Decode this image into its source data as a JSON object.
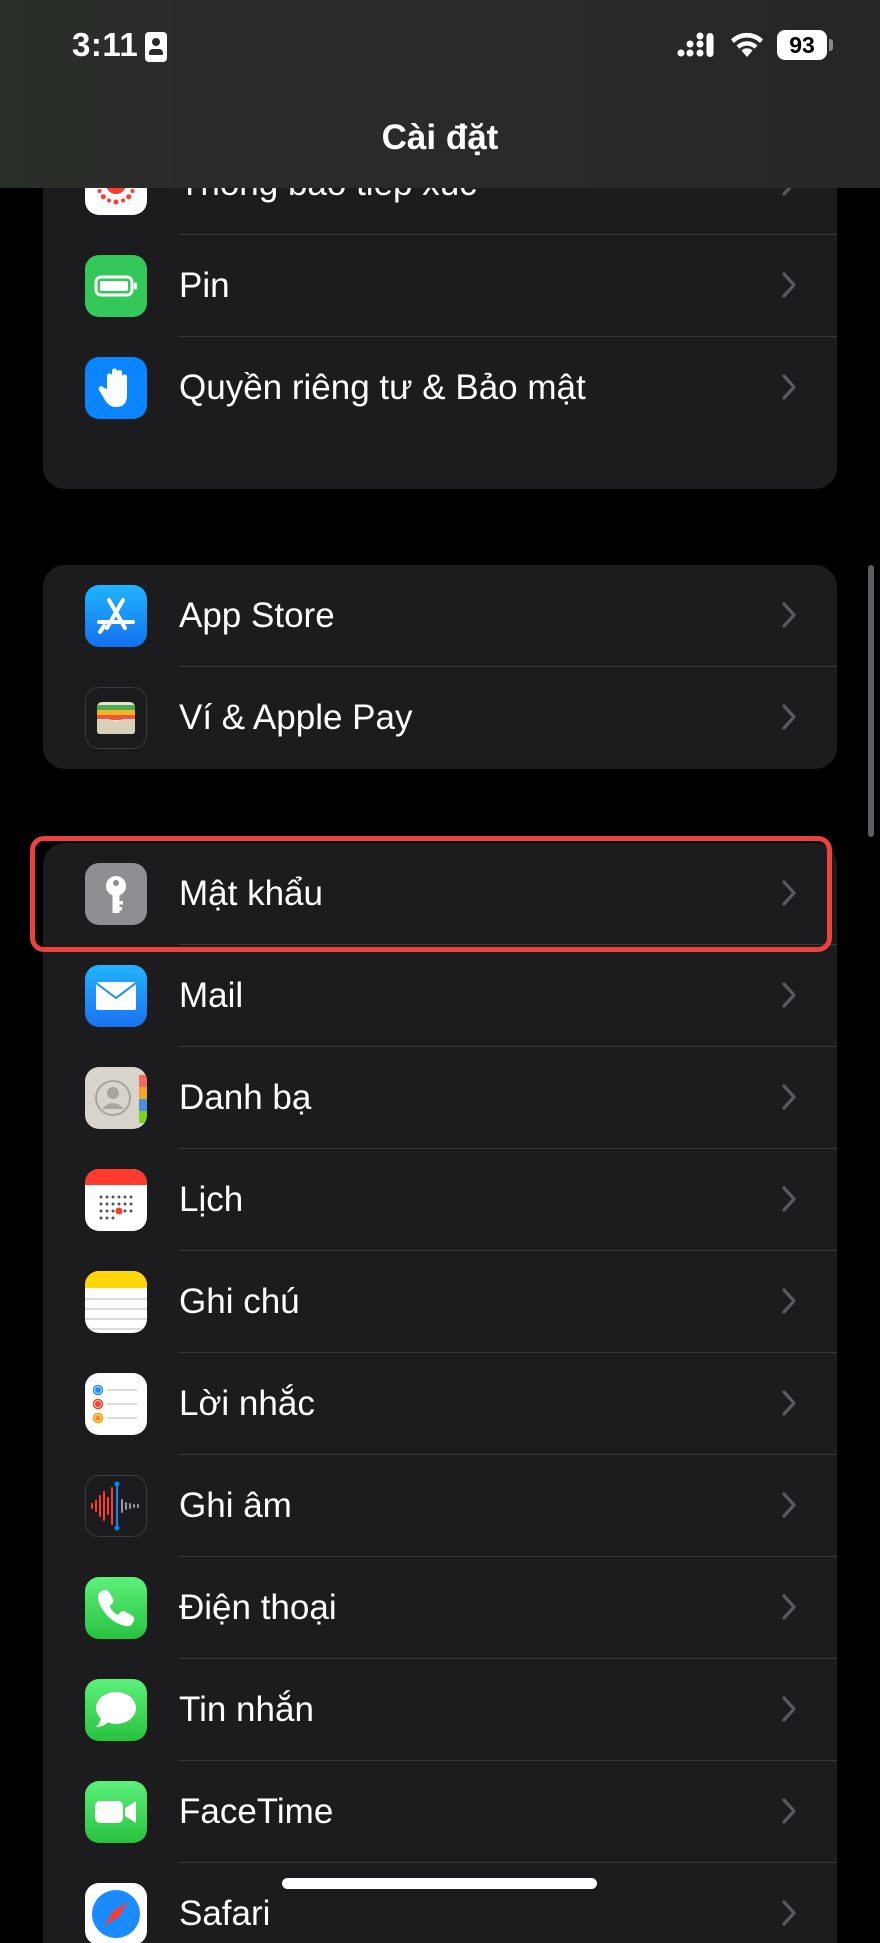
{
  "status_bar": {
    "time": "3:11",
    "battery": "93"
  },
  "nav": {
    "title": "Cài đặt"
  },
  "group1": [
    {
      "label": "Thông báo tiếp xúc",
      "icon": "exposure-notification-icon",
      "color": "#ffffff"
    },
    {
      "label": "Pin",
      "icon": "battery-icon",
      "color": "#34c759"
    },
    {
      "label": "Quyền riêng tư & Bảo mật",
      "icon": "privacy-hand-icon",
      "color": "#0a84ff"
    }
  ],
  "group2": [
    {
      "label": "App Store",
      "icon": "app-store-icon",
      "color": "#1a8cff"
    },
    {
      "label": "Ví & Apple Pay",
      "icon": "wallet-icon",
      "color": "#1c1c1e"
    }
  ],
  "group3": [
    {
      "label": "Mật khẩu",
      "icon": "key-icon",
      "color": "#8e8e93"
    },
    {
      "label": "Mail",
      "icon": "mail-icon",
      "color": "#1a8cff"
    },
    {
      "label": "Danh bạ",
      "icon": "contacts-icon",
      "color": "#d8d4cc"
    },
    {
      "label": "Lịch",
      "icon": "calendar-icon",
      "color": "#ffffff"
    },
    {
      "label": "Ghi chú",
      "icon": "notes-icon",
      "color": "#ffd60a"
    },
    {
      "label": "Lời nhắc",
      "icon": "reminders-icon",
      "color": "#ffffff"
    },
    {
      "label": "Ghi âm",
      "icon": "voice-memos-icon",
      "color": "#1c1c1e"
    },
    {
      "label": "Điện thoại",
      "icon": "phone-icon",
      "color": "#34c759"
    },
    {
      "label": "Tin nhắn",
      "icon": "messages-icon",
      "color": "#34c759"
    },
    {
      "label": "FaceTime",
      "icon": "facetime-icon",
      "color": "#34c759"
    },
    {
      "label": "Safari",
      "icon": "safari-icon",
      "color": "#ffffff"
    }
  ],
  "highlight_color": "#e8433c"
}
